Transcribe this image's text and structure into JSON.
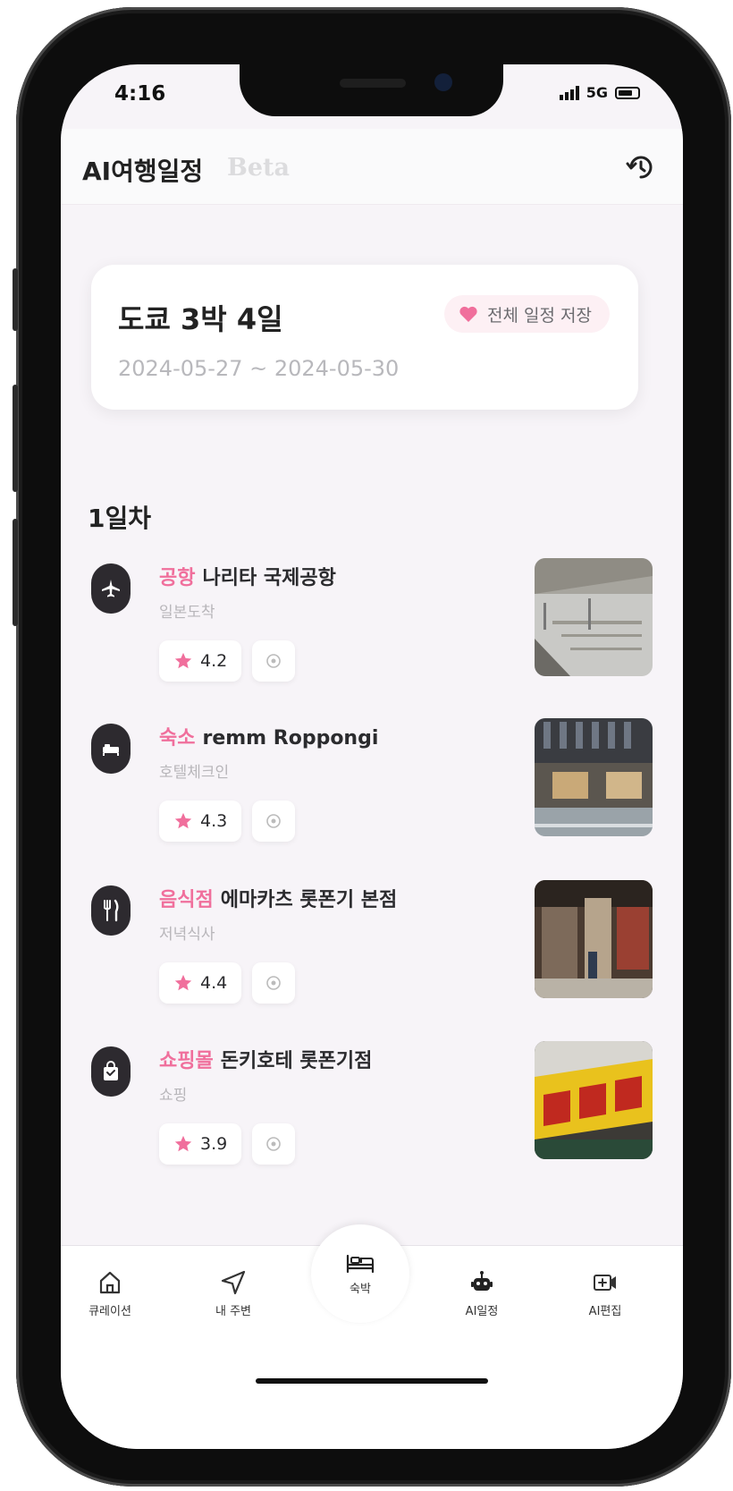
{
  "status_bar": {
    "time": "4:16",
    "network": "5G"
  },
  "header": {
    "title": "AI여행일정",
    "beta": "Beta"
  },
  "trip": {
    "title": "도쿄 3박 4일",
    "dates": "2024-05-27 ~ 2024-05-30",
    "save_label": "전체 일정 저장"
  },
  "day": {
    "title": "1일차",
    "places": [
      {
        "icon": "airplane-icon",
        "category": "공항",
        "name": "나리타 국제공항",
        "sub": "일본도착",
        "rating": "4.2"
      },
      {
        "icon": "bed-icon",
        "category": "숙소",
        "name": "remm Roppongi",
        "sub": "호텔체크인",
        "rating": "4.3"
      },
      {
        "icon": "fork-knife-icon",
        "category": "음식점",
        "name": "에마카츠 롯폰기 본점",
        "sub": "저녁식사",
        "rating": "4.4"
      },
      {
        "icon": "shopping-bag-icon",
        "category": "쇼핑몰",
        "name": "돈키호테 롯폰기점",
        "sub": "쇼핑",
        "rating": "3.9"
      }
    ]
  },
  "tabbar": {
    "tabs": [
      {
        "label": "큐레이션",
        "icon": "home-icon"
      },
      {
        "label": "내 주변",
        "icon": "navigation-arrow-icon"
      },
      {
        "label": "숙박",
        "icon": "bed-icon"
      },
      {
        "label": "AI일정",
        "icon": "robot-icon"
      },
      {
        "label": "AI편집",
        "icon": "video-edit-icon"
      }
    ]
  },
  "colors": {
    "accent": "#f06f9c",
    "dark": "#2d2a2f",
    "background": "#f7f4f8"
  }
}
